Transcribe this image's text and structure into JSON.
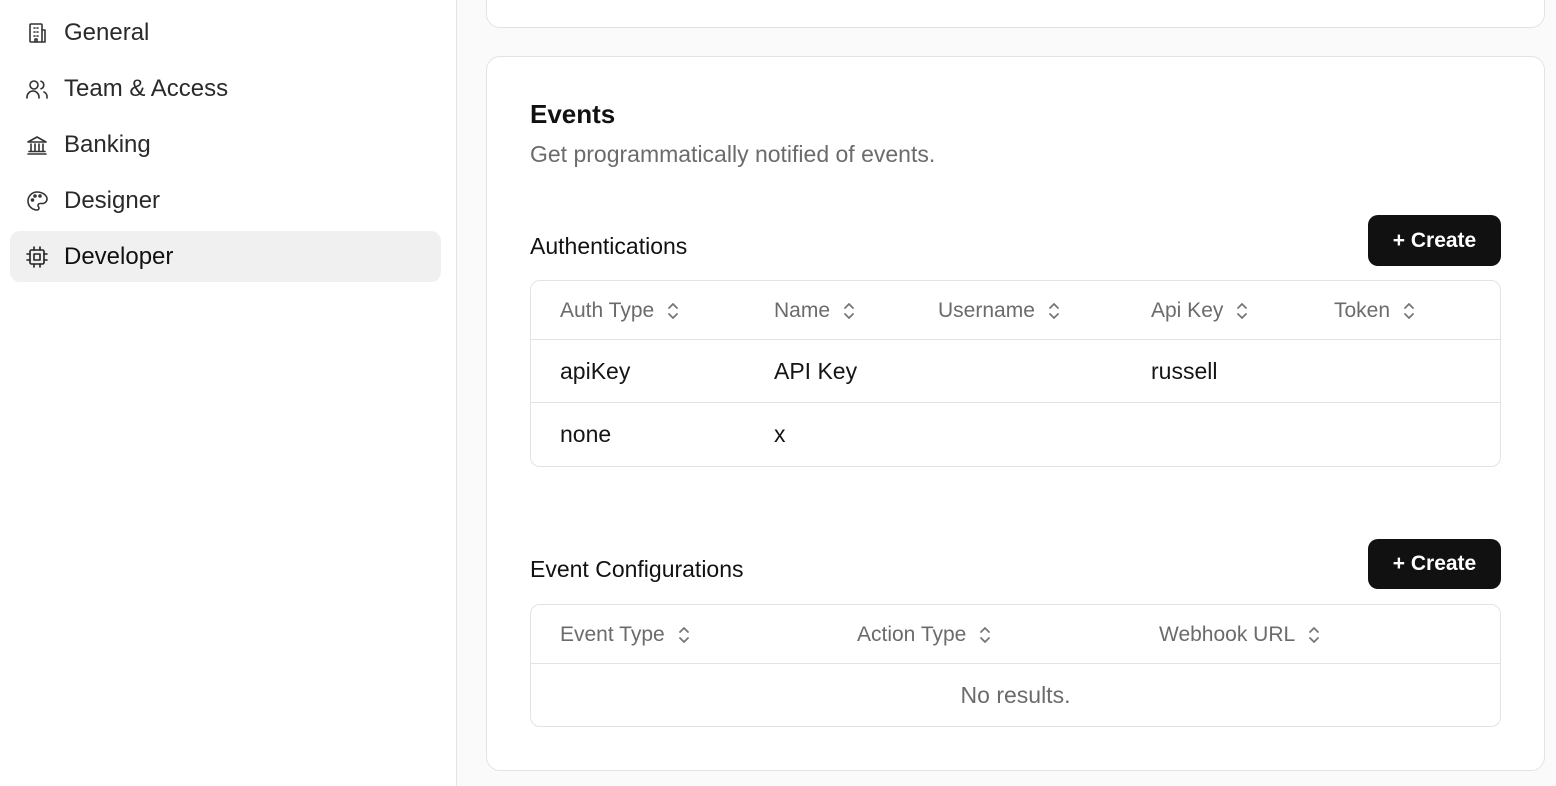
{
  "sidebar": {
    "items": [
      {
        "label": "General",
        "icon": "building-icon"
      },
      {
        "label": "Team & Access",
        "icon": "users-icon"
      },
      {
        "label": "Banking",
        "icon": "bank-icon"
      },
      {
        "label": "Designer",
        "icon": "palette-icon"
      },
      {
        "label": "Developer",
        "icon": "cpu-icon",
        "active": true
      }
    ]
  },
  "events": {
    "title": "Events",
    "description": "Get programmatically notified of events.",
    "authentications": {
      "title": "Authentications",
      "create_label": "+ Create",
      "columns": [
        "Auth Type",
        "Name",
        "Username",
        "Api Key",
        "Token"
      ],
      "rows": [
        [
          "apiKey",
          "API Key",
          "",
          "russell",
          ""
        ],
        [
          "none",
          "x",
          "",
          "",
          ""
        ]
      ]
    },
    "event_configurations": {
      "title": "Event Configurations",
      "create_label": "+ Create",
      "columns": [
        "Event Type",
        "Action Type",
        "Webhook URL"
      ],
      "empty_text": "No results."
    }
  },
  "colors": {
    "primary_button": "#111111",
    "active_nav_bg": "#f0f0f0",
    "muted_text": "#6b6b6b"
  }
}
